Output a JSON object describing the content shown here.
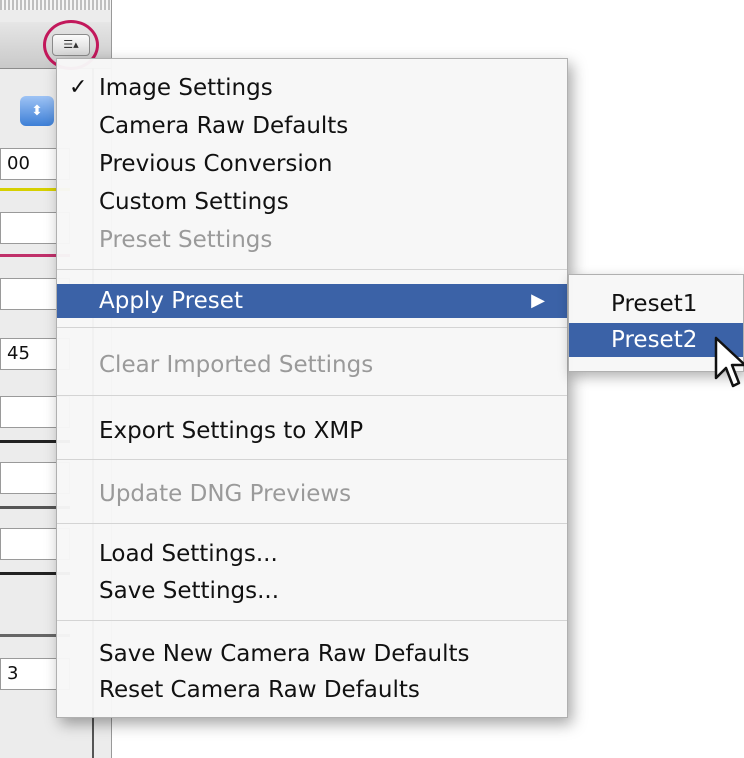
{
  "panel": {
    "menu_button_icon": "list-menu-icon",
    "menu_button_glyph": "☰▴",
    "stepper_glyph": "⬍",
    "fields": [
      "00",
      "",
      "",
      "45",
      "",
      "",
      "",
      "3"
    ]
  },
  "menu": {
    "items": [
      {
        "label": "Image Settings",
        "checked": true,
        "enabled": true
      },
      {
        "label": "Camera Raw Defaults",
        "enabled": true
      },
      {
        "label": "Previous Conversion",
        "enabled": true
      },
      {
        "label": "Custom Settings",
        "enabled": true
      },
      {
        "label": "Preset Settings",
        "enabled": false
      },
      {
        "label": "Apply Preset",
        "enabled": true,
        "submenu": true,
        "highlighted": true
      },
      {
        "label": "Clear Imported Settings",
        "enabled": false
      },
      {
        "label": "Export Settings to XMP",
        "enabled": true
      },
      {
        "label": "Update DNG Previews",
        "enabled": false
      },
      {
        "label": "Load Settings...",
        "enabled": true
      },
      {
        "label": "Save Settings...",
        "enabled": true
      },
      {
        "label": "Save New Camera Raw Defaults",
        "enabled": true
      },
      {
        "label": "Reset Camera Raw Defaults",
        "enabled": true
      }
    ],
    "check_glyph": "✓",
    "submenu_arrow_glyph": "▶"
  },
  "submenu": {
    "items": [
      {
        "label": "Preset1",
        "highlighted": false
      },
      {
        "label": "Preset2",
        "highlighted": true
      }
    ]
  },
  "colors": {
    "highlight": "#3b62a7",
    "ring": "#c2185b",
    "disabled_text": "#9a9a9a"
  }
}
